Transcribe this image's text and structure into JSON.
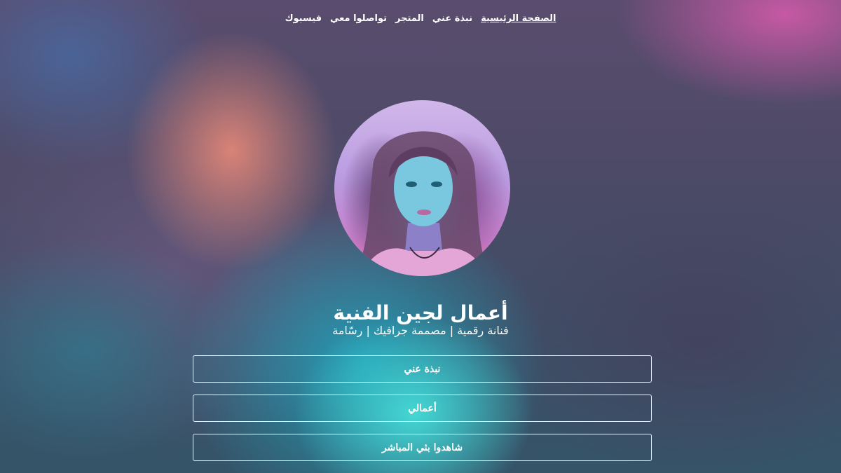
{
  "nav": {
    "items": [
      {
        "label": "الصفحة الرئيسية",
        "active": true
      },
      {
        "label": "نبذة عني",
        "active": false
      },
      {
        "label": "المتجر",
        "active": false
      },
      {
        "label": "تواصلوا معي",
        "active": false
      },
      {
        "label": "فيسبوك",
        "active": false
      }
    ]
  },
  "profile": {
    "title": "أعمال لجين الفنية",
    "subtitle": "فنانة رقمية | مصممة جرافيك | رسّامة"
  },
  "links": [
    {
      "label": "نبذة عني"
    },
    {
      "label": "أعمالي"
    },
    {
      "label": "شاهدوا بثي المباشر"
    }
  ],
  "colors": {
    "text": "#ffffff",
    "button_border": "#ffffff"
  }
}
